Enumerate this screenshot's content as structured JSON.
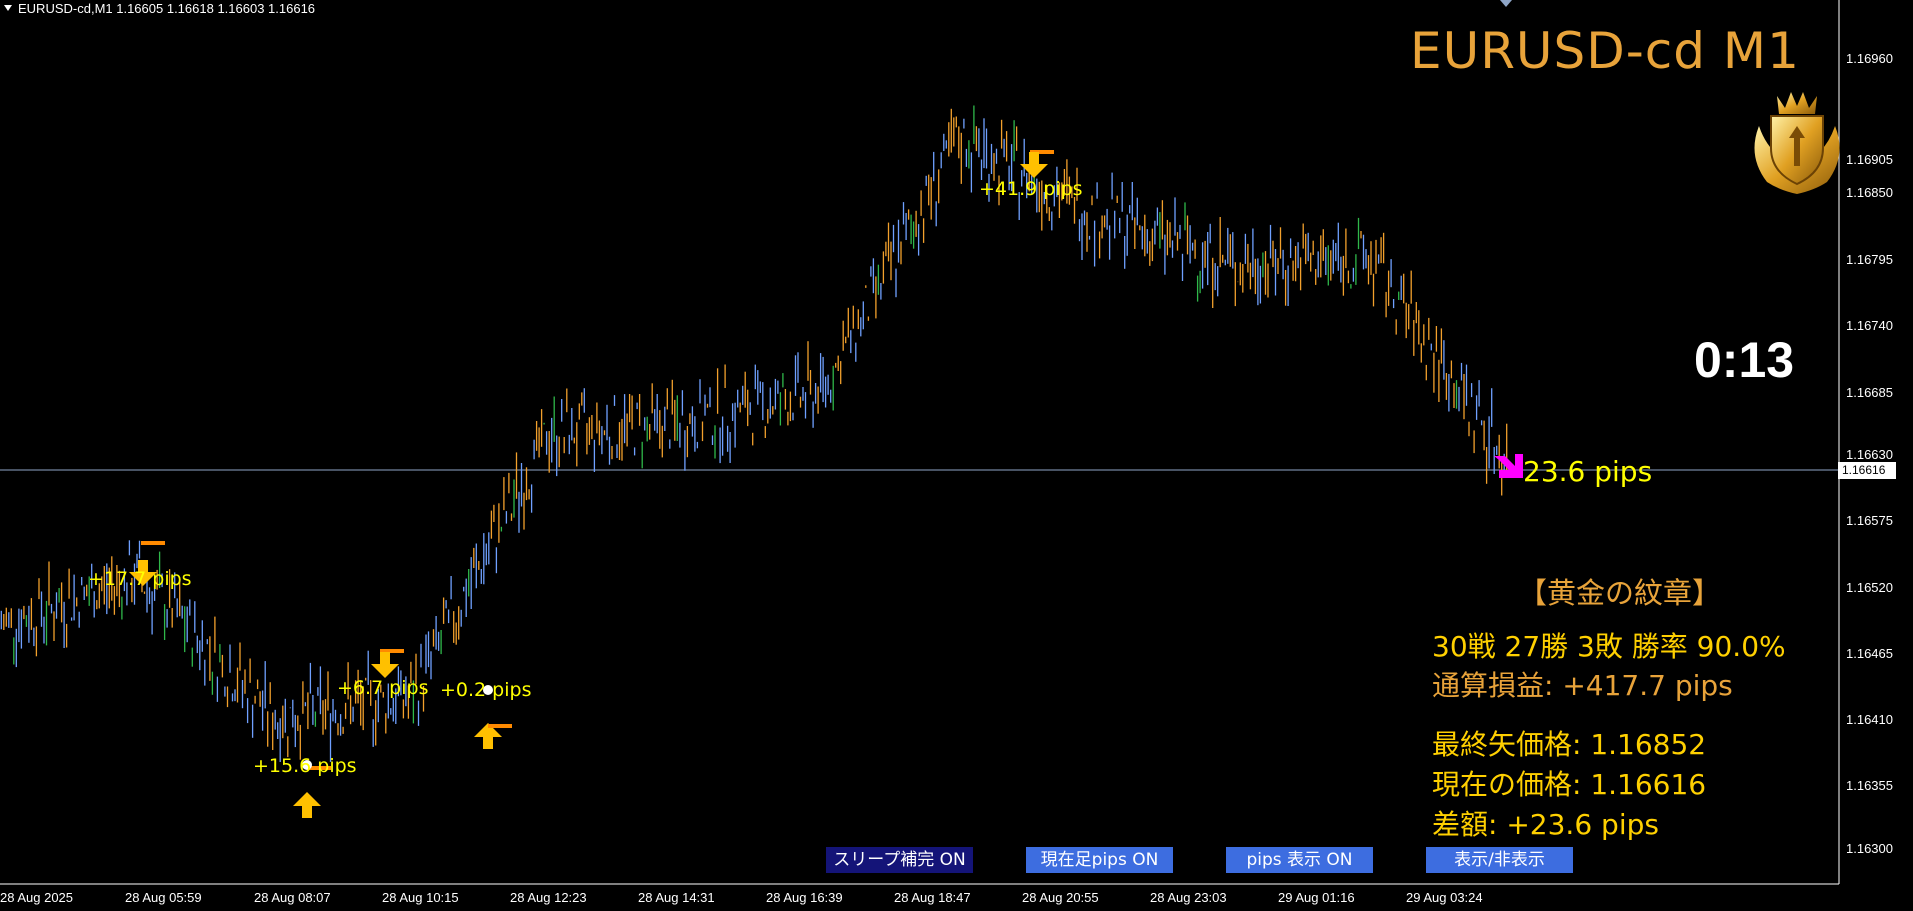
{
  "header": {
    "symbol_line": "EURUSD-cd,M1  1.16605 1.16618 1.16603 1.16616"
  },
  "overlay": {
    "title": "EURUSD-cd M1",
    "countdown": "0:13",
    "emblem_icon": "golden-crest-icon",
    "stats_heading": "【黄金の紋章】",
    "record_line": "30戦 27勝 3敗  勝率 90.0%",
    "total_pl_line": "通算損益:  +417.7 pips",
    "last_arrow_price_line": "最終矢価格: 1.16852",
    "current_price_line": "現在の価格: 1.16616",
    "difference_line": "差額:     +23.6 pips",
    "live_pips_label": "23.6 pips"
  },
  "buttons": {
    "sleep": "スリープ補完 ON",
    "current_bar": "現在足pips ON",
    "pips_display": "pips 表示  ON",
    "toggle": "表示/非表示"
  },
  "trades": [
    {
      "direction": "down",
      "label": "+17.7 pips"
    },
    {
      "direction": "up",
      "label": "+15.6 pips"
    },
    {
      "direction": "down",
      "label": "+6.7 pips"
    },
    {
      "direction": "up",
      "label": "+0.2 pips"
    },
    {
      "direction": "down",
      "label": "+41.9 pips"
    },
    {
      "direction": "down-magenta",
      "label": "23.6 pips"
    }
  ],
  "y_axis": {
    "labels": [
      "1.16960",
      "1.16905",
      "1.16850",
      "1.16795",
      "1.16740",
      "1.16685",
      "1.16630",
      "1.16575",
      "1.16520",
      "1.16465",
      "1.16410",
      "1.16355",
      "1.16300"
    ],
    "current_price": "1.16616"
  },
  "x_axis": {
    "labels": [
      "28 Aug 2025",
      "28 Aug 05:59",
      "28 Aug 08:07",
      "28 Aug 10:15",
      "28 Aug 12:23",
      "28 Aug 14:31",
      "28 Aug 16:39",
      "28 Aug 18:47",
      "28 Aug 20:55",
      "28 Aug 23:03",
      "29 Aug 01:16",
      "29 Aug 03:24"
    ]
  },
  "colors": {
    "background": "#000000",
    "candle_up": "#6fa0ff",
    "candle_down": "#f2a02c",
    "candle_neutral": "#2fb84a",
    "arrow_yellow": "#ffc000",
    "arrow_magenta": "#ff00ff",
    "label_yellow": "#ffff00",
    "title_orange": "#e8a33a"
  },
  "chart_data": {
    "type": "candlestick",
    "ylim": [
      1.1626,
      1.17
    ],
    "series": [
      {
        "name": "",
        "x": [
          "28 Aug 2025",
          "28 Aug 05:59",
          "28 Aug 08:07",
          "28 Aug 10:15",
          "28 Aug 12:23",
          "28 Aug 14:31",
          "28 Aug 16:39",
          "28 Aug 18:47",
          "28 Aug 20:55",
          "28 Aug 23:03",
          "29 Aug 01:16",
          "29 Aug 03:24"
        ],
        "values": [
          1.16465,
          1.1651,
          1.1638,
          1.164,
          1.1664,
          1.1665,
          1.1668,
          1.1691,
          1.1684,
          1.16795,
          1.168,
          1.16616
        ]
      }
    ]
  }
}
